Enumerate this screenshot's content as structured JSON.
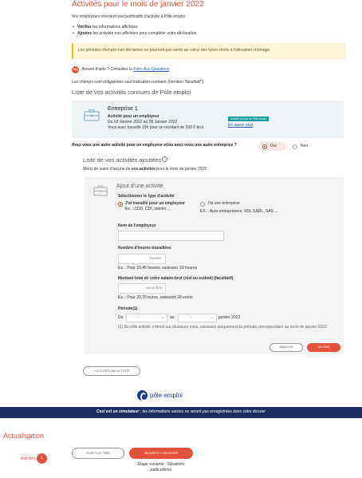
{
  "header": {
    "title": "Activités pour le mois de janvier 2022",
    "intro": "Vos employeurs envoient vos justificatifs d'activité à Pôle emploi :",
    "bullets": [
      {
        "bold": "Vérifiez",
        "rest": " les informations affichées"
      },
      {
        "bold": "Ajoutez",
        "rest": " les activités non affichées pour compléter votre déclaration"
      }
    ],
    "warning": "Les périodes d'emploi non déclarées ne pourront pas servir au calcul des futurs droits à l'allocation chômage.",
    "faq_badge": "FAQ",
    "help_text": "Besoin d'aide ? Consultez la ",
    "help_link": "Foire Aux Questions",
    "required_note": "Les champs sont obligatoires sauf indication contraire (mention \"facultatif\")"
  },
  "known": {
    "title": "Liste de vos activités connues de Pôle emploi",
    "card": {
      "name": "Entreprise 1",
      "role": "Activité pour un employeur",
      "dates": "Du 03 Janvier 2022 au 08 Janvier 2022",
      "hours": "Vous avez travaillé 15h pour un montant de 200 € brut",
      "badge": "Activité connue de Pôle emploi",
      "more": "En savoir plus"
    }
  },
  "question": {
    "text": "Avez-vous une autre activité pour un employeur et/ou avez-vous une autre entreprise ?",
    "yes": "Oui",
    "no": "Non",
    "selected": "Oui"
  },
  "added": {
    "title": "Liste de vos activités ajoutées",
    "desc_prefix": "Merci de saisir chacune de ",
    "desc_bold": "vos activités",
    "desc_suffix": " pour le mois de janvier 2022"
  },
  "form": {
    "title": "Ajout d'une activité",
    "type_label": "Sélectionnez le type d'activité",
    "opt_employer": "J'ai travaillé pour un employeur",
    "opt_employer_ex": "Ex. : CDD, CDI, intérim ...",
    "opt_company": "J'ai une entreprise",
    "opt_company_ex": "EX. : Auto-entrepreneur, VDI, SARL, SAS ...",
    "employer_label": "Nom de l'employeur",
    "employer_value": "",
    "hours_label": "Nombre d'heures travaillées",
    "hours_unit": "heures",
    "hours_ex": "Ex. : Pour 10,45 heures, saisissez 10 heures",
    "salary_label": "Montant total de votre salaire brut (réel ou estimé) (facultatif)",
    "salary_unit": "euros brut",
    "salary_ex": "Ex. : Pour 20,70 euros, saisissez 20 euros",
    "period_label": "Période(1)",
    "du": "Du",
    "au": "au",
    "select_placeholder": "-",
    "month": "janvier 2022",
    "period_note": "(1) Si cette activité s'étend sur plusieurs mois, saisissez uniquement la période correspondant au mois de janvier 2022",
    "cancel": "ANNULER",
    "validate": "VALIDER"
  },
  "add_button": "+ AJOUTER UNE ACTIVITÉ",
  "footer": {
    "logo_text": "pôle emploi",
    "sim_bold": "Ceci est un simulateur",
    "sim_rest": " : les informations saisies ne seront pas enregistrées dans votre dossier",
    "sidebar_title": "Actualisation",
    "sidebar_item": "Activités",
    "sidebar_step": "1",
    "later": "FINIR PLUS TARD",
    "continue": "VALIDER ET CONTINUER",
    "next_step": "Étape suivante : Situations particulières"
  },
  "colors": {
    "accent": "#e2523e",
    "navy": "#1d2d5f",
    "teal": "#1a9ba0",
    "warning_bg": "#fdf5d8"
  }
}
